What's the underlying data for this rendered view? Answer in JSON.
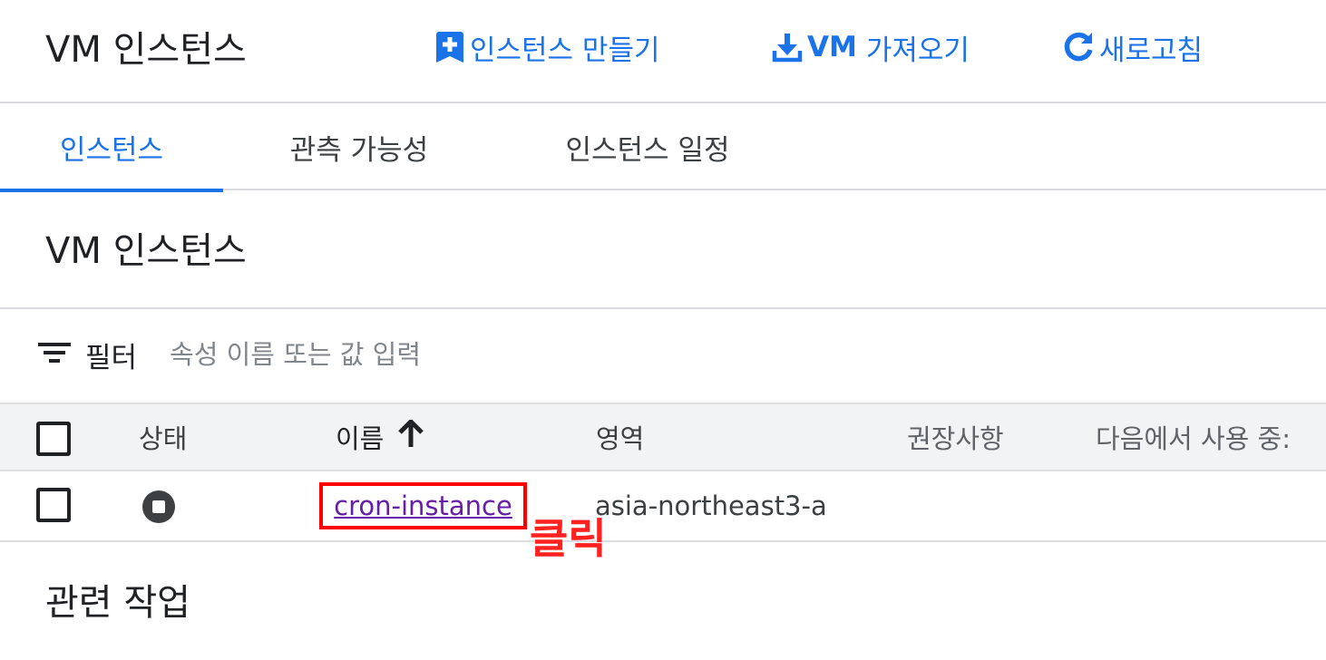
{
  "header": {
    "title": "VM 인스턴스",
    "actions": {
      "create_label": "인스턴스 만들기",
      "import_prefix": "VM",
      "import_label": "가져오기",
      "refresh_label": "새로고침"
    }
  },
  "tabs": [
    {
      "label": "인스턴스",
      "active": true
    },
    {
      "label": "관측 가능성",
      "active": false
    },
    {
      "label": "인스턴스 일정",
      "active": false
    }
  ],
  "section": {
    "title": "VM 인스턴스"
  },
  "filter": {
    "label": "필터",
    "placeholder": "속성 이름 또는 값 입력"
  },
  "table": {
    "columns": {
      "status": "상태",
      "name": "이름",
      "zone": "영역",
      "recommendation": "권장사항",
      "in_use_by": "다음에서 사용 중:"
    },
    "sort": {
      "column": "name",
      "direction": "ascending"
    },
    "rows": [
      {
        "status": "stopped",
        "name": "cron-instance",
        "zone": "asia-northeast3-a"
      }
    ]
  },
  "annotation": {
    "text": "클릭"
  },
  "related": {
    "title": "관련 작업"
  },
  "colors": {
    "accent": "#1a73e8",
    "visited_link": "#681da8",
    "annotation": "#ff0000"
  }
}
